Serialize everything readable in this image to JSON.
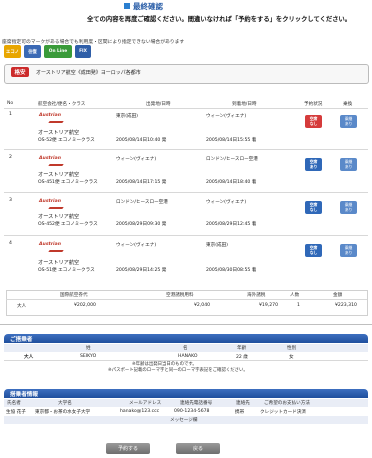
{
  "header": {
    "title": "最終確認",
    "notice": "全ての内容を再度ご確認ください。間違いなければ「予約をする」をクリックしてください。"
  },
  "seat_note": "座席指定可のマークがある場合でも利用度・区間により指定できない場合があります",
  "icons": [
    {
      "label": "エコノ",
      "icon": "economy-icon",
      "color": "#e8a600"
    },
    {
      "label": "往復",
      "icon": "roundtrip-icon",
      "color": "#3b6ab5"
    },
    {
      "label": "On Line",
      "icon": "online-icon",
      "color": "#3a9b3a"
    },
    {
      "label": "FIX",
      "icon": "fix-icon",
      "color": "#2f5ea8"
    }
  ],
  "route": {
    "tag": "格安",
    "text": "オーストリア航空《成田発》ヨーロッパ各都市"
  },
  "flights_table": {
    "headers": [
      "No",
      "航空会社/便名・クラス",
      "出発地/日時",
      "到着地/日時",
      "予約状況",
      "乗換"
    ],
    "rows": [
      {
        "no": "1",
        "logo": "Austrian",
        "airline": "オーストリア航空",
        "flight": "OS-52便 エコノミークラス",
        "dep_place": "東京(成田)",
        "dep_time": "2005/08/14日10:40 発",
        "arr_place": "ウィーン(ヴィエナ)",
        "arr_time": "2005/08/14日15:55 着",
        "seat": [
          "空席",
          "なし"
        ],
        "seat_color": "#d53b3b",
        "transfer": [
          "乗継",
          "あり"
        ]
      },
      {
        "no": "2",
        "logo": "Austrian",
        "airline": "オーストリア航空",
        "flight": "OS-451便 エコノミークラス",
        "dep_place": "ウィーン(ヴィエナ)",
        "dep_time": "2005/08/14日17:15 発",
        "arr_place": "ロンドン/ヒースロー空港",
        "arr_time": "2005/08/14日18:40 着",
        "seat": [
          "空席",
          "あり"
        ],
        "seat_color": "#2f68b8",
        "transfer": [
          "乗継",
          "あり"
        ]
      },
      {
        "no": "3",
        "logo": "Austrian",
        "airline": "オーストリア航空",
        "flight": "OS-452便 エコノミークラス",
        "dep_place": "ロンドン/ヒースロー空港",
        "dep_time": "2005/08/29日09:30 発",
        "arr_place": "ウィーン(ヴィエナ)",
        "arr_time": "2005/08/29日12:45 着",
        "seat": [
          "空席",
          "なし"
        ],
        "seat_color": "#2f68b8",
        "transfer": [
          "乗継",
          "あり"
        ]
      },
      {
        "no": "4",
        "logo": "Austrian",
        "airline": "オーストリア航空",
        "flight": "OS-51便 エコノミークラス",
        "dep_place": "ウィーン(ヴィエナ)",
        "dep_time": "2005/08/29日14:25 発",
        "arr_place": "東京(成田)",
        "arr_time": "2005/08/30日08:55 着",
        "seat": [
          "空席",
          "なし"
        ],
        "seat_color": "#2f68b8",
        "transfer": [
          "乗継",
          "あり"
        ]
      }
    ]
  },
  "price_table": {
    "headers": [
      "国際航空券代",
      "空港諸税用料",
      "海外諸税",
      "人数",
      "金額"
    ],
    "row": {
      "type": "大人",
      "fare": "¥202,000",
      "airport_fee": "¥2,040",
      "overseas_tax": "¥19,270",
      "count": "1",
      "total": "¥223,310"
    }
  },
  "passenger_section": {
    "title": "ご搭乗者",
    "headers": [
      "",
      "姓",
      "名",
      "年齢",
      "性別"
    ],
    "row": {
      "type": "大人",
      "last": "SEIKYO",
      "first": "HANAKO",
      "age": "22 歳",
      "gender": "女"
    },
    "notes": [
      "※年齢は出発日当日のものです。",
      "※パスポート記載のローマ字と同一のローマ字表記をご確認ください。"
    ]
  },
  "applicant_section": {
    "title": "搭乗者情報",
    "headers": [
      "氏名者",
      "大学名",
      "メールアドレス",
      "連絡先電話番号",
      "連絡先",
      "ご希望のお支払い方法"
    ],
    "row": {
      "name": "生協 花子",
      "school": "東京都・お茶の水女子大学",
      "email": "hanako@123.ccc",
      "phone": "090-1234-5678",
      "contact": "携帯",
      "payment": "クレジットカード決済"
    },
    "message_label": "メッセージ欄"
  },
  "buttons": {
    "reserve": "予約する",
    "back": "戻る"
  }
}
